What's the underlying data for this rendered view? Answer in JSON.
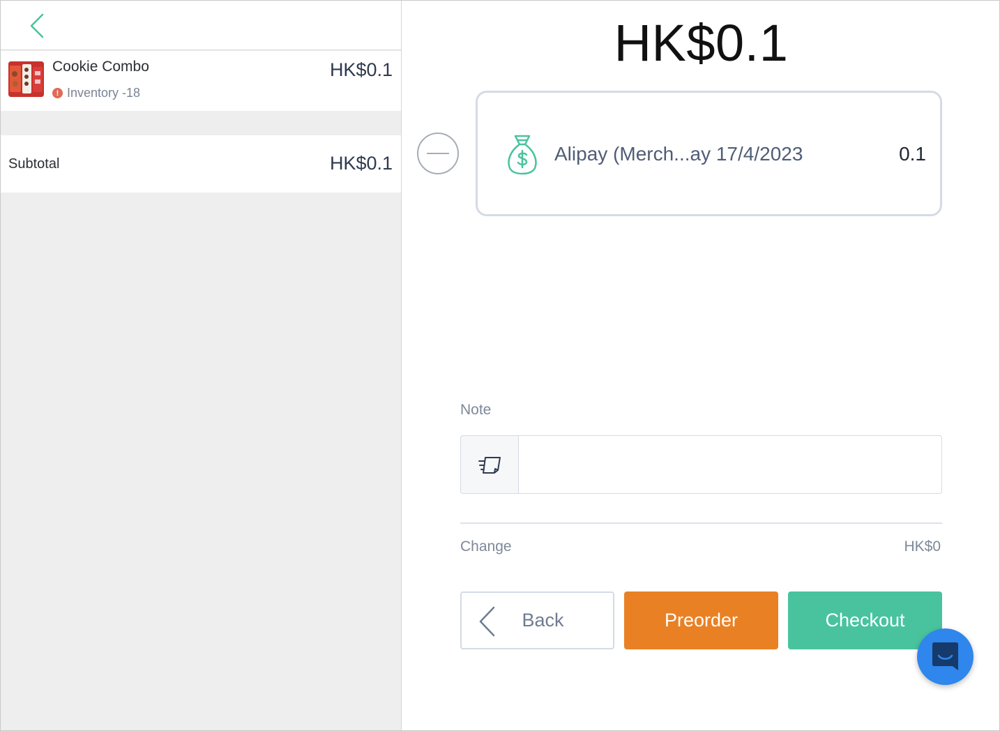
{
  "order": {
    "total": "HK$0.1",
    "items": [
      {
        "name": "Cookie Combo",
        "inventory_text": "Inventory -18",
        "price": "HK$0.1"
      }
    ],
    "subtotal_label": "Subtotal",
    "subtotal_value": "HK$0.1"
  },
  "payment": {
    "method_name": "Alipay (Merch...ay 17/4/2023",
    "amount": "0.1",
    "icon": "money-bag-icon"
  },
  "note": {
    "label": "Note",
    "value": "",
    "placeholder": ""
  },
  "change": {
    "label": "Change",
    "value": "HK$0"
  },
  "buttons": {
    "back": "Back",
    "preorder": "Preorder",
    "checkout": "Checkout"
  },
  "colors": {
    "accent_green": "#48c39e",
    "preorder_orange": "#e98124",
    "chat_blue": "#2f86ec",
    "warning_red": "#e06a57"
  }
}
